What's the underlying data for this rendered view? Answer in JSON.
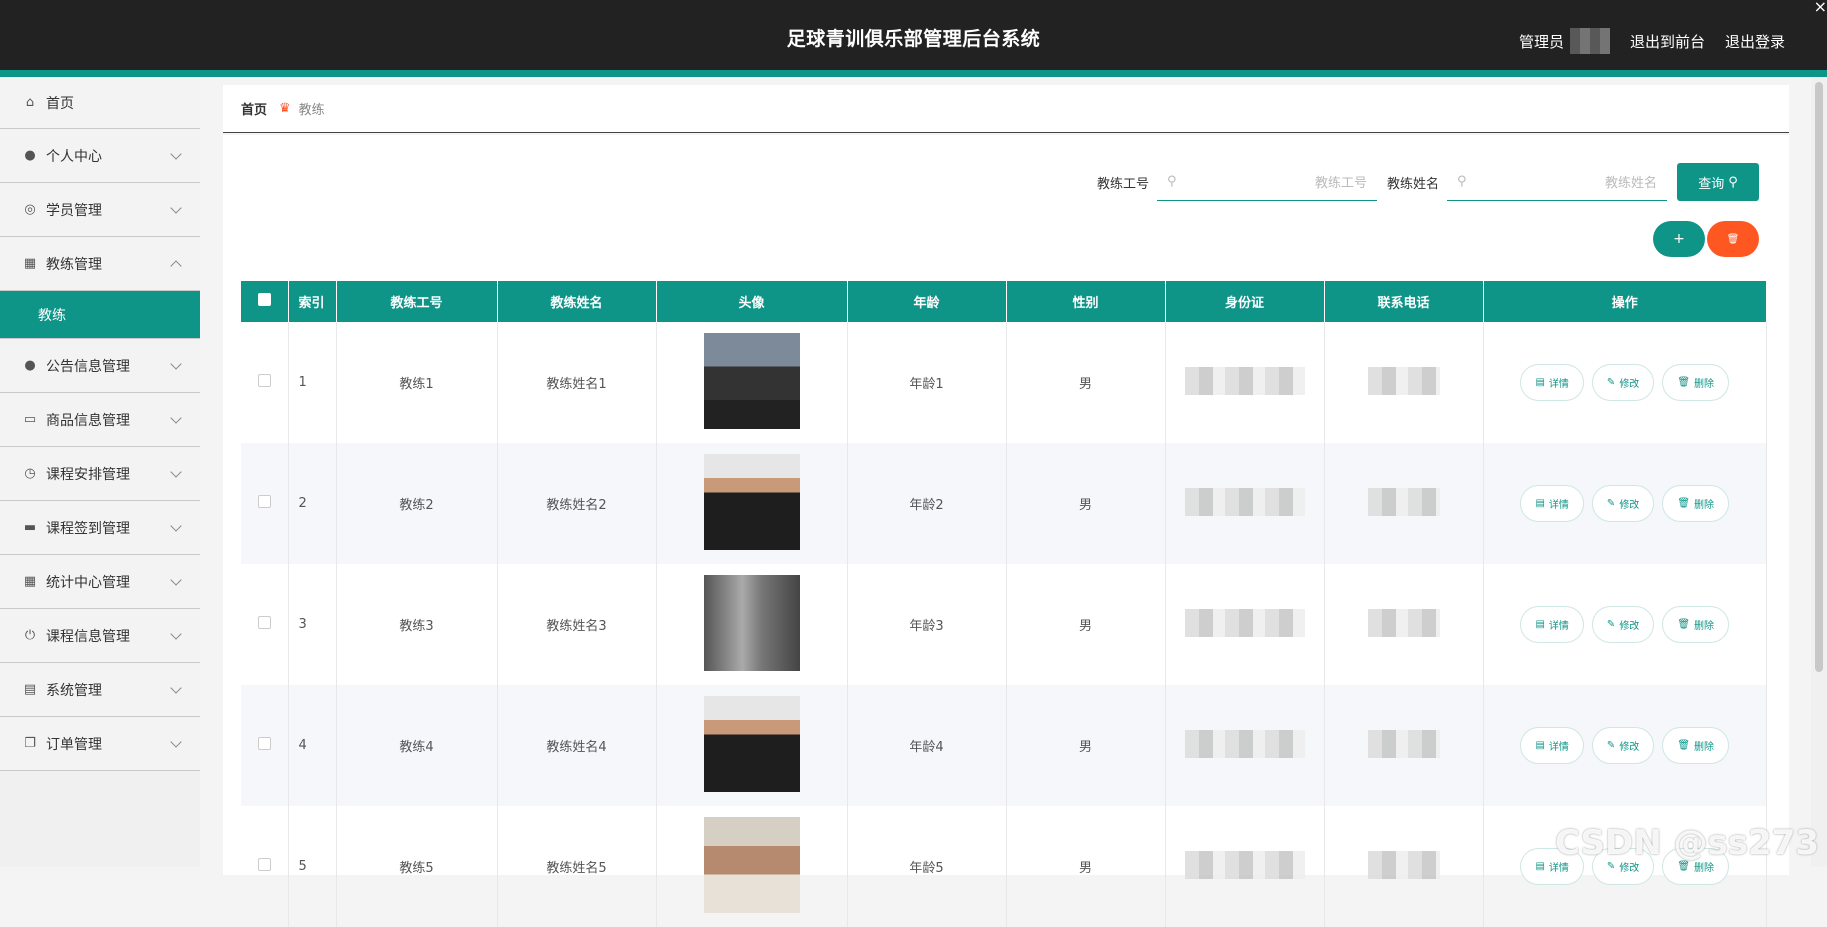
{
  "header": {
    "title": "足球青训俱乐部管理后台系统",
    "role": "管理员",
    "to_front": "退出到前台",
    "logout": "退出登录",
    "close": "×"
  },
  "sidebar": {
    "items": [
      {
        "label": "首页",
        "icon": "home-icon"
      },
      {
        "label": "个人中心",
        "icon": "user-icon"
      },
      {
        "label": "学员管理",
        "icon": "compass-icon"
      },
      {
        "label": "教练管理",
        "icon": "grid-icon",
        "expanded": true,
        "sub": "教练"
      },
      {
        "label": "公告信息管理",
        "icon": "user-icon"
      },
      {
        "label": "商品信息管理",
        "icon": "chat-icon"
      },
      {
        "label": "课程安排管理",
        "icon": "clock-icon"
      },
      {
        "label": "课程签到管理",
        "icon": "briefcase-icon"
      },
      {
        "label": "统计中心管理",
        "icon": "apps-icon"
      },
      {
        "label": "课程信息管理",
        "icon": "power-icon"
      },
      {
        "label": "系统管理",
        "icon": "clipboard-icon"
      },
      {
        "label": "订单管理",
        "icon": "copy-icon"
      }
    ]
  },
  "breadcrumb": {
    "home": "首页",
    "current": "教练"
  },
  "search": {
    "label1": "教练工号",
    "placeholder1": "教练工号",
    "label2": "教练姓名",
    "placeholder2": "教练姓名",
    "query": "查询"
  },
  "toolbar": {
    "add": "+",
    "delete": "🗑"
  },
  "table": {
    "columns": [
      "索引",
      "教练工号",
      "教练姓名",
      "头像",
      "年龄",
      "性别",
      "身份证",
      "联系电话",
      "操作"
    ],
    "rows": [
      {
        "index": "1",
        "no": "教练1",
        "name": "教练姓名1",
        "age": "年龄1",
        "sex": "男"
      },
      {
        "index": "2",
        "no": "教练2",
        "name": "教练姓名2",
        "age": "年龄2",
        "sex": "男"
      },
      {
        "index": "3",
        "no": "教练3",
        "name": "教练姓名3",
        "age": "年龄3",
        "sex": "男"
      },
      {
        "index": "4",
        "no": "教练4",
        "name": "教练姓名4",
        "age": "年龄4",
        "sex": "男"
      },
      {
        "index": "5",
        "no": "教练5",
        "name": "教练姓名5",
        "age": "年龄5",
        "sex": "男"
      }
    ],
    "ops": {
      "detail": "详情",
      "edit": "修改",
      "remove": "删除"
    }
  },
  "watermark": "CSDN @ss273",
  "colors": {
    "accent": "#0f9488",
    "danger": "#ff5722",
    "header": "#222222"
  }
}
